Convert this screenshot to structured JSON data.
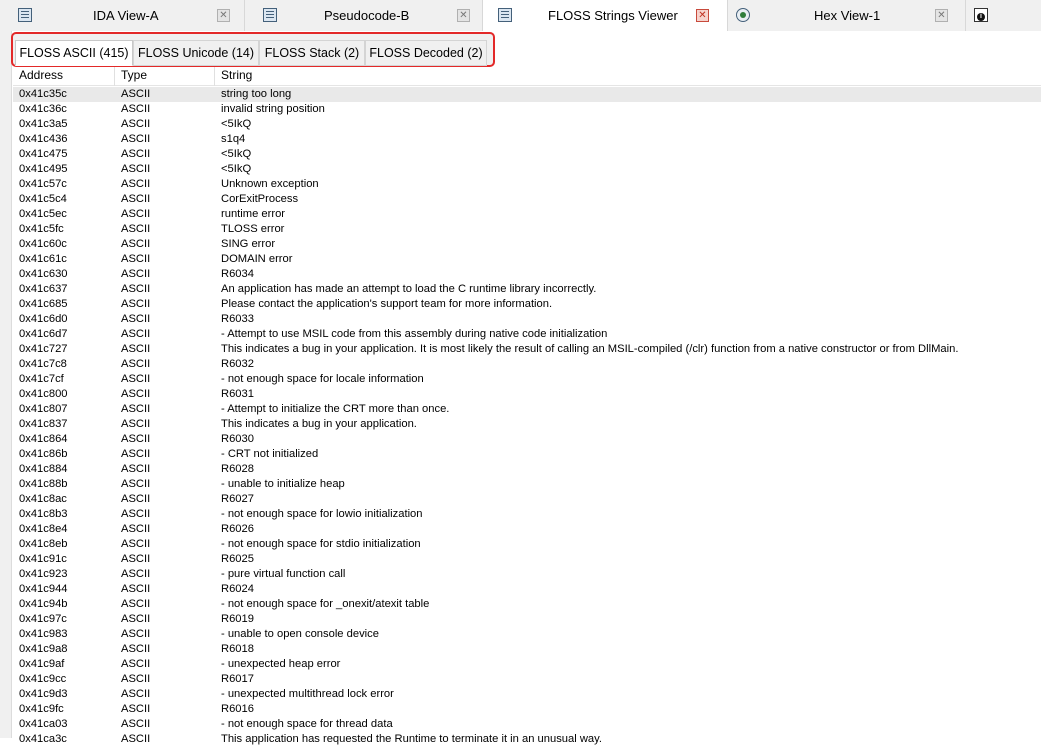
{
  "doc_tabs": [
    {
      "label": "IDA View-A",
      "icon": "list-icon"
    },
    {
      "label": "Pseudocode-B",
      "icon": "list-icon"
    },
    {
      "label": "FLOSS Strings Viewer",
      "icon": "list-icon"
    },
    {
      "label": "Hex View-1",
      "icon": "hex-icon"
    }
  ],
  "floss_tabs": [
    "FLOSS ASCII (415)",
    "FLOSS Unicode (14)",
    "FLOSS Stack (2)",
    "FLOSS Decoded (2)"
  ],
  "table": {
    "columns": [
      "Address",
      "Type",
      "String"
    ],
    "rows": [
      [
        "0x41c35c",
        "ASCII",
        "string too long"
      ],
      [
        "0x41c36c",
        "ASCII",
        "invalid string position"
      ],
      [
        "0x41c3a5",
        "ASCII",
        "<5IkQ"
      ],
      [
        "0x41c436",
        "ASCII",
        "s1q4"
      ],
      [
        "0x41c475",
        "ASCII",
        "<5IkQ"
      ],
      [
        "0x41c495",
        "ASCII",
        "<5IkQ"
      ],
      [
        "0x41c57c",
        "ASCII",
        "Unknown exception"
      ],
      [
        "0x41c5c4",
        "ASCII",
        "CorExitProcess"
      ],
      [
        "0x41c5ec",
        "ASCII",
        "runtime error"
      ],
      [
        "0x41c5fc",
        "ASCII",
        "TLOSS error"
      ],
      [
        "0x41c60c",
        "ASCII",
        "SING error"
      ],
      [
        "0x41c61c",
        "ASCII",
        "DOMAIN error"
      ],
      [
        "0x41c630",
        "ASCII",
        "R6034"
      ],
      [
        "0x41c637",
        "ASCII",
        "An application has made an attempt to load the C runtime library incorrectly."
      ],
      [
        "0x41c685",
        "ASCII",
        "Please contact the application's support team for more information."
      ],
      [
        "0x41c6d0",
        "ASCII",
        "R6033"
      ],
      [
        "0x41c6d7",
        "ASCII",
        "- Attempt to use MSIL code from this assembly during native code initialization"
      ],
      [
        "0x41c727",
        "ASCII",
        "This indicates a bug in your application. It is most likely the result of calling an MSIL-compiled (/clr) function from a native constructor or from DllMain."
      ],
      [
        "0x41c7c8",
        "ASCII",
        "R6032"
      ],
      [
        "0x41c7cf",
        "ASCII",
        "- not enough space for locale information"
      ],
      [
        "0x41c800",
        "ASCII",
        "R6031"
      ],
      [
        "0x41c807",
        "ASCII",
        "- Attempt to initialize the CRT more than once."
      ],
      [
        "0x41c837",
        "ASCII",
        "This indicates a bug in your application."
      ],
      [
        "0x41c864",
        "ASCII",
        "R6030"
      ],
      [
        "0x41c86b",
        "ASCII",
        "- CRT not initialized"
      ],
      [
        "0x41c884",
        "ASCII",
        "R6028"
      ],
      [
        "0x41c88b",
        "ASCII",
        "- unable to initialize heap"
      ],
      [
        "0x41c8ac",
        "ASCII",
        "R6027"
      ],
      [
        "0x41c8b3",
        "ASCII",
        "- not enough space for lowio initialization"
      ],
      [
        "0x41c8e4",
        "ASCII",
        "R6026"
      ],
      [
        "0x41c8eb",
        "ASCII",
        "- not enough space for stdio initialization"
      ],
      [
        "0x41c91c",
        "ASCII",
        "R6025"
      ],
      [
        "0x41c923",
        "ASCII",
        "- pure virtual function call"
      ],
      [
        "0x41c944",
        "ASCII",
        "R6024"
      ],
      [
        "0x41c94b",
        "ASCII",
        "- not enough space for _onexit/atexit table"
      ],
      [
        "0x41c97c",
        "ASCII",
        "R6019"
      ],
      [
        "0x41c983",
        "ASCII",
        "- unable to open console device"
      ],
      [
        "0x41c9a8",
        "ASCII",
        "R6018"
      ],
      [
        "0x41c9af",
        "ASCII",
        "- unexpected heap error"
      ],
      [
        "0x41c9cc",
        "ASCII",
        "R6017"
      ],
      [
        "0x41c9d3",
        "ASCII",
        "- unexpected multithread lock error"
      ],
      [
        "0x41c9fc",
        "ASCII",
        "R6016"
      ],
      [
        "0x41ca03",
        "ASCII",
        "- not enough space for thread data"
      ],
      [
        "0x41ca3c",
        "ASCII",
        "This application has requested the Runtime to terminate it in an unusual way."
      ]
    ]
  }
}
